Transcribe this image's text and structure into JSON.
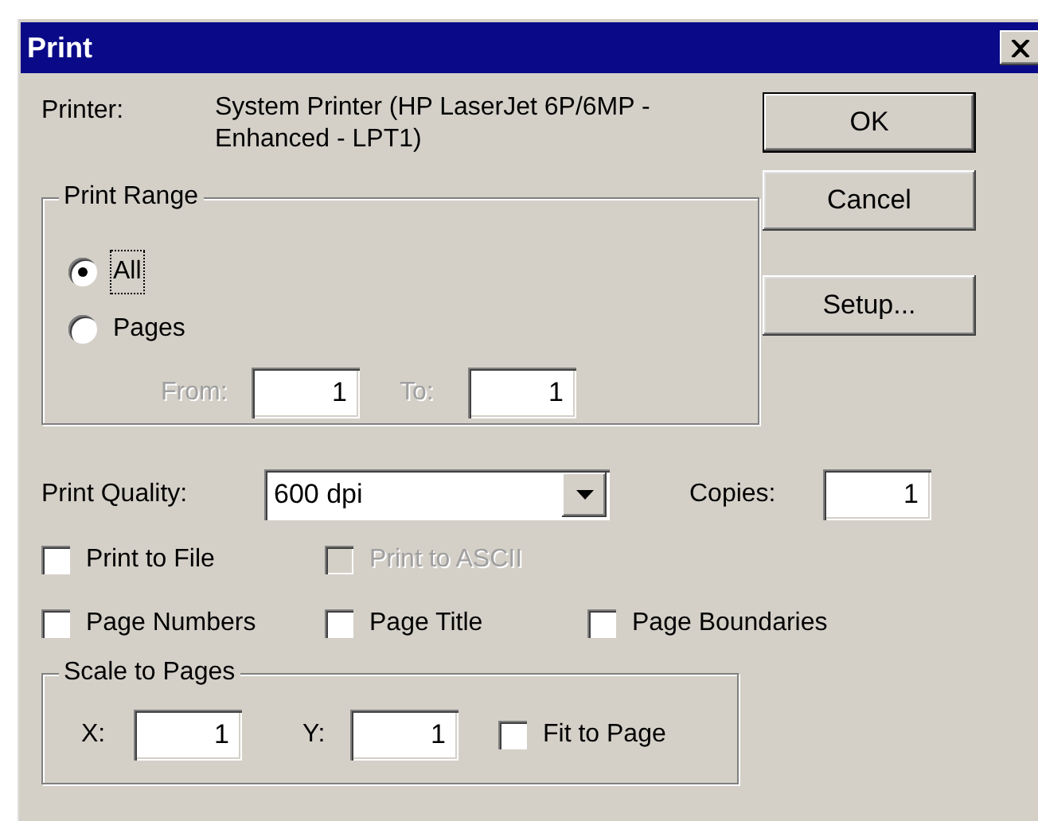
{
  "window": {
    "title": "Print"
  },
  "printer": {
    "label": "Printer:",
    "value": "System Printer (HP LaserJet 6P/6MP - Enhanced - LPT1)"
  },
  "buttons": [
    {
      "label": "OK",
      "default": true
    },
    {
      "label": "Cancel",
      "default": false
    },
    {
      "label": "Setup...",
      "default": false
    }
  ],
  "print_range": {
    "title": "Print Range",
    "options": [
      {
        "label": "All",
        "selected": true
      },
      {
        "label": "Pages",
        "selected": false
      }
    ],
    "from": {
      "label": "From:",
      "value": "1",
      "disabled": true
    },
    "to": {
      "label": "To:",
      "value": "1",
      "disabled": true
    }
  },
  "print_quality": {
    "label": "Print Quality:",
    "value": "600 dpi"
  },
  "copies": {
    "label": "Copies:",
    "value": "1"
  },
  "option_rows": [
    [
      {
        "label": "Print to File",
        "checked": false,
        "disabled": false
      },
      {
        "label": "Print to ASCII",
        "checked": false,
        "disabled": true
      }
    ],
    [
      {
        "label": "Page Numbers",
        "checked": false,
        "disabled": false
      },
      {
        "label": "Page Title",
        "checked": false,
        "disabled": false
      },
      {
        "label": "Page Boundaries",
        "checked": false,
        "disabled": false
      }
    ]
  ],
  "scale": {
    "title": "Scale to Pages",
    "x": {
      "label": "X:",
      "value": "1"
    },
    "y": {
      "label": "Y:",
      "value": "1"
    },
    "fit": {
      "label": "Fit to Page",
      "checked": false
    }
  }
}
